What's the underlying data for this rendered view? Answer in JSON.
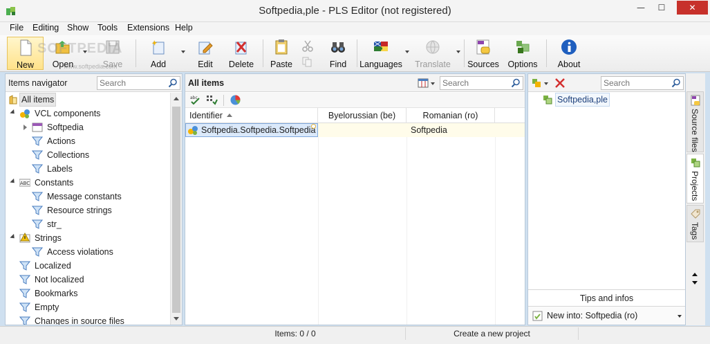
{
  "window": {
    "title": "Softpedia,ple - PLS Editor (not registered)",
    "min": "—",
    "max": "☐",
    "close": "✕"
  },
  "menu": [
    "File",
    "Editing",
    "Show",
    "Tools",
    "Extensions",
    "Help"
  ],
  "toolbar": {
    "new": "New",
    "open": "Open",
    "save": "Save",
    "add": "Add",
    "edit": "Edit",
    "delete": "Delete",
    "paste": "Paste",
    "find": "Find",
    "languages": "Languages",
    "translate": "Translate",
    "sources": "Sources",
    "options": "Options",
    "about": "About"
  },
  "navigator": {
    "title": "Items navigator",
    "search_placeholder": "Search",
    "items": [
      {
        "label": "All items"
      },
      {
        "label": "VCL components"
      },
      {
        "label": "Softpedia"
      },
      {
        "label": "Actions"
      },
      {
        "label": "Collections"
      },
      {
        "label": "Labels"
      },
      {
        "label": "Constants"
      },
      {
        "label": "Message constants"
      },
      {
        "label": "Resource strings"
      },
      {
        "label": "str_"
      },
      {
        "label": "Strings"
      },
      {
        "label": "Access violations"
      },
      {
        "label": "Localized"
      },
      {
        "label": "Not localized"
      },
      {
        "label": "Bookmarks"
      },
      {
        "label": "Empty"
      },
      {
        "label": "Changes in source files"
      }
    ]
  },
  "items": {
    "title": "All items",
    "search_placeholder": "Search",
    "columns": [
      "Identifier",
      "Byelorussian (be)",
      "Romanian (ro)"
    ],
    "rows": [
      {
        "identifier": "Softpedia.Softpedia.Softpedia",
        "be": "",
        "ro": "Softpedia"
      }
    ]
  },
  "projects": {
    "search_placeholder": "Search",
    "items": [
      "Softpedia,ple"
    ],
    "tips_title": "Tips and infos",
    "new_into": "New into: Softpedia (ro)"
  },
  "sidetabs": [
    "Source files",
    "Projects",
    "Tags"
  ],
  "status": {
    "count": "Items: 0 / 0",
    "message": "Create a new project"
  },
  "watermark": "SOFTPEDIA",
  "watermark_url": "www.softpedia.com"
}
